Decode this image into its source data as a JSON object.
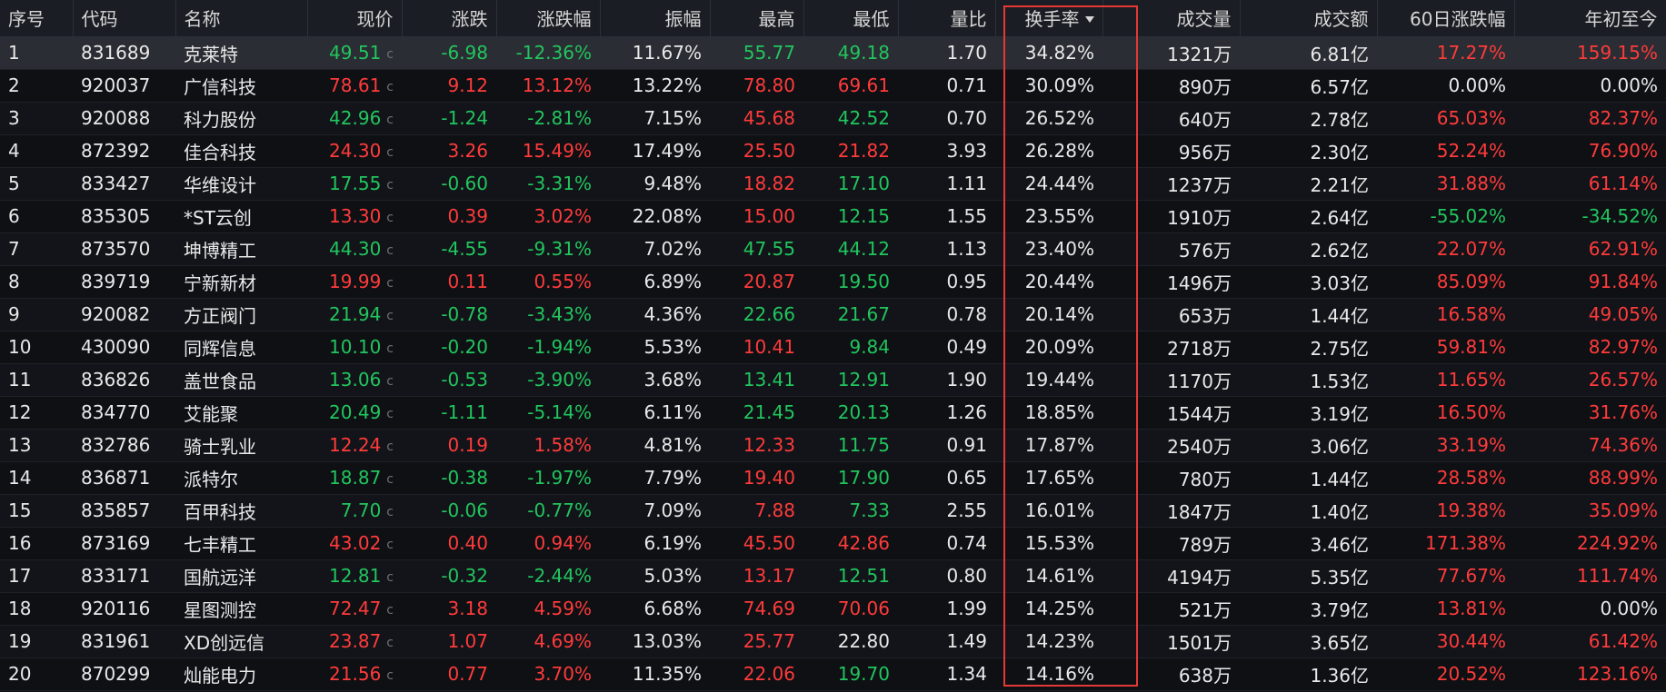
{
  "columns": {
    "seq": "序号",
    "code": "代码",
    "name": "名称",
    "price": "现价",
    "change": "涨跌",
    "change_pct": "涨跌幅",
    "amplitude": "振幅",
    "high": "最高",
    "low": "最低",
    "vol_ratio": "量比",
    "turnover": "换手率",
    "volume": "成交量",
    "amount": "成交额",
    "chg60": "60日涨跌幅",
    "ytd": "年初至今"
  },
  "price_suffix": "c",
  "colors": {
    "up": "#ff3b3b",
    "down": "#22c55e",
    "flat": "#e9e9e9",
    "highlight": "#e53935"
  },
  "rows": [
    {
      "seq": "1",
      "code": "831689",
      "name": "克莱特",
      "price": "49.51",
      "change": "-6.98",
      "change_pct": "-12.36%",
      "amplitude": "11.67%",
      "high": "55.77",
      "low": "49.18",
      "vol_ratio": "1.70",
      "turnover": "34.82%",
      "volume": "1321万",
      "amount": "6.81亿",
      "chg60": "17.27%",
      "ytd": "159.15%",
      "price_color": "green",
      "change_color": "green",
      "high_color": "green",
      "low_color": "green",
      "chg60_color": "red",
      "ytd_color": "red"
    },
    {
      "seq": "2",
      "code": "920037",
      "name": "广信科技",
      "price": "78.61",
      "change": "9.12",
      "change_pct": "13.12%",
      "amplitude": "13.22%",
      "high": "78.80",
      "low": "69.61",
      "vol_ratio": "0.71",
      "turnover": "30.09%",
      "volume": "890万",
      "amount": "6.57亿",
      "chg60": "0.00%",
      "ytd": "0.00%",
      "price_color": "red",
      "change_color": "red",
      "high_color": "red",
      "low_color": "red",
      "chg60_color": "white",
      "ytd_color": "white"
    },
    {
      "seq": "3",
      "code": "920088",
      "name": "科力股份",
      "price": "42.96",
      "change": "-1.24",
      "change_pct": "-2.81%",
      "amplitude": "7.15%",
      "high": "45.68",
      "low": "42.52",
      "vol_ratio": "0.70",
      "turnover": "26.52%",
      "volume": "640万",
      "amount": "2.78亿",
      "chg60": "65.03%",
      "ytd": "82.37%",
      "price_color": "green",
      "change_color": "green",
      "high_color": "red",
      "low_color": "green",
      "chg60_color": "red",
      "ytd_color": "red"
    },
    {
      "seq": "4",
      "code": "872392",
      "name": "佳合科技",
      "price": "24.30",
      "change": "3.26",
      "change_pct": "15.49%",
      "amplitude": "17.49%",
      "high": "25.50",
      "low": "21.82",
      "vol_ratio": "3.93",
      "turnover": "26.28%",
      "volume": "956万",
      "amount": "2.30亿",
      "chg60": "52.24%",
      "ytd": "76.90%",
      "price_color": "red",
      "change_color": "red",
      "high_color": "red",
      "low_color": "red",
      "chg60_color": "red",
      "ytd_color": "red"
    },
    {
      "seq": "5",
      "code": "833427",
      "name": "华维设计",
      "price": "17.55",
      "change": "-0.60",
      "change_pct": "-3.31%",
      "amplitude": "9.48%",
      "high": "18.82",
      "low": "17.10",
      "vol_ratio": "1.11",
      "turnover": "24.44%",
      "volume": "1237万",
      "amount": "2.21亿",
      "chg60": "31.88%",
      "ytd": "61.14%",
      "price_color": "green",
      "change_color": "green",
      "high_color": "red",
      "low_color": "green",
      "chg60_color": "red",
      "ytd_color": "red"
    },
    {
      "seq": "6",
      "code": "835305",
      "name": "*ST云创",
      "price": "13.30",
      "change": "0.39",
      "change_pct": "3.02%",
      "amplitude": "22.08%",
      "high": "15.00",
      "low": "12.15",
      "vol_ratio": "1.55",
      "turnover": "23.55%",
      "volume": "1910万",
      "amount": "2.64亿",
      "chg60": "-55.02%",
      "ytd": "-34.52%",
      "price_color": "red",
      "change_color": "red",
      "high_color": "red",
      "low_color": "green",
      "chg60_color": "green",
      "ytd_color": "green"
    },
    {
      "seq": "7",
      "code": "873570",
      "name": "坤博精工",
      "price": "44.30",
      "change": "-4.55",
      "change_pct": "-9.31%",
      "amplitude": "7.02%",
      "high": "47.55",
      "low": "44.12",
      "vol_ratio": "1.13",
      "turnover": "23.40%",
      "volume": "576万",
      "amount": "2.62亿",
      "chg60": "22.07%",
      "ytd": "62.91%",
      "price_color": "green",
      "change_color": "green",
      "high_color": "green",
      "low_color": "green",
      "chg60_color": "red",
      "ytd_color": "red"
    },
    {
      "seq": "8",
      "code": "839719",
      "name": "宁新新材",
      "price": "19.99",
      "change": "0.11",
      "change_pct": "0.55%",
      "amplitude": "6.89%",
      "high": "20.87",
      "low": "19.50",
      "vol_ratio": "0.95",
      "turnover": "20.44%",
      "volume": "1496万",
      "amount": "3.03亿",
      "chg60": "85.09%",
      "ytd": "91.84%",
      "price_color": "red",
      "change_color": "red",
      "high_color": "red",
      "low_color": "green",
      "chg60_color": "red",
      "ytd_color": "red"
    },
    {
      "seq": "9",
      "code": "920082",
      "name": "方正阀门",
      "price": "21.94",
      "change": "-0.78",
      "change_pct": "-3.43%",
      "amplitude": "4.36%",
      "high": "22.66",
      "low": "21.67",
      "vol_ratio": "0.78",
      "turnover": "20.14%",
      "volume": "653万",
      "amount": "1.44亿",
      "chg60": "16.58%",
      "ytd": "49.05%",
      "price_color": "green",
      "change_color": "green",
      "high_color": "green",
      "low_color": "green",
      "chg60_color": "red",
      "ytd_color": "red"
    },
    {
      "seq": "10",
      "code": "430090",
      "name": "同辉信息",
      "price": "10.10",
      "change": "-0.20",
      "change_pct": "-1.94%",
      "amplitude": "5.53%",
      "high": "10.41",
      "low": "9.84",
      "vol_ratio": "0.49",
      "turnover": "20.09%",
      "volume": "2718万",
      "amount": "2.75亿",
      "chg60": "59.81%",
      "ytd": "82.97%",
      "price_color": "green",
      "change_color": "green",
      "high_color": "red",
      "low_color": "green",
      "chg60_color": "red",
      "ytd_color": "red"
    },
    {
      "seq": "11",
      "code": "836826",
      "name": "盖世食品",
      "price": "13.06",
      "change": "-0.53",
      "change_pct": "-3.90%",
      "amplitude": "3.68%",
      "high": "13.41",
      "low": "12.91",
      "vol_ratio": "1.90",
      "turnover": "19.44%",
      "volume": "1170万",
      "amount": "1.53亿",
      "chg60": "11.65%",
      "ytd": "26.57%",
      "price_color": "green",
      "change_color": "green",
      "high_color": "green",
      "low_color": "green",
      "chg60_color": "red",
      "ytd_color": "red"
    },
    {
      "seq": "12",
      "code": "834770",
      "name": "艾能聚",
      "price": "20.49",
      "change": "-1.11",
      "change_pct": "-5.14%",
      "amplitude": "6.11%",
      "high": "21.45",
      "low": "20.13",
      "vol_ratio": "1.26",
      "turnover": "18.85%",
      "volume": "1544万",
      "amount": "3.19亿",
      "chg60": "16.50%",
      "ytd": "31.76%",
      "price_color": "green",
      "change_color": "green",
      "high_color": "green",
      "low_color": "green",
      "chg60_color": "red",
      "ytd_color": "red"
    },
    {
      "seq": "13",
      "code": "832786",
      "name": "骑士乳业",
      "price": "12.24",
      "change": "0.19",
      "change_pct": "1.58%",
      "amplitude": "4.81%",
      "high": "12.33",
      "low": "11.75",
      "vol_ratio": "0.91",
      "turnover": "17.87%",
      "volume": "2540万",
      "amount": "3.06亿",
      "chg60": "33.19%",
      "ytd": "74.36%",
      "price_color": "red",
      "change_color": "red",
      "high_color": "red",
      "low_color": "green",
      "chg60_color": "red",
      "ytd_color": "red"
    },
    {
      "seq": "14",
      "code": "836871",
      "name": "派特尔",
      "price": "18.87",
      "change": "-0.38",
      "change_pct": "-1.97%",
      "amplitude": "7.79%",
      "high": "19.40",
      "low": "17.90",
      "vol_ratio": "0.65",
      "turnover": "17.65%",
      "volume": "780万",
      "amount": "1.44亿",
      "chg60": "28.58%",
      "ytd": "88.99%",
      "price_color": "green",
      "change_color": "green",
      "high_color": "red",
      "low_color": "green",
      "chg60_color": "red",
      "ytd_color": "red"
    },
    {
      "seq": "15",
      "code": "835857",
      "name": "百甲科技",
      "price": "7.70",
      "change": "-0.06",
      "change_pct": "-0.77%",
      "amplitude": "7.09%",
      "high": "7.88",
      "low": "7.33",
      "vol_ratio": "2.55",
      "turnover": "16.01%",
      "volume": "1847万",
      "amount": "1.40亿",
      "chg60": "19.38%",
      "ytd": "35.09%",
      "price_color": "green",
      "change_color": "green",
      "high_color": "red",
      "low_color": "green",
      "chg60_color": "red",
      "ytd_color": "red"
    },
    {
      "seq": "16",
      "code": "873169",
      "name": "七丰精工",
      "price": "43.02",
      "change": "0.40",
      "change_pct": "0.94%",
      "amplitude": "6.19%",
      "high": "45.50",
      "low": "42.86",
      "vol_ratio": "0.74",
      "turnover": "15.53%",
      "volume": "789万",
      "amount": "3.46亿",
      "chg60": "171.38%",
      "ytd": "224.92%",
      "price_color": "red",
      "change_color": "red",
      "high_color": "red",
      "low_color": "red",
      "chg60_color": "red",
      "ytd_color": "red"
    },
    {
      "seq": "17",
      "code": "833171",
      "name": "国航远洋",
      "price": "12.81",
      "change": "-0.32",
      "change_pct": "-2.44%",
      "amplitude": "5.03%",
      "high": "13.17",
      "low": "12.51",
      "vol_ratio": "0.80",
      "turnover": "14.61%",
      "volume": "4194万",
      "amount": "5.35亿",
      "chg60": "77.67%",
      "ytd": "111.74%",
      "price_color": "green",
      "change_color": "green",
      "high_color": "red",
      "low_color": "green",
      "chg60_color": "red",
      "ytd_color": "red"
    },
    {
      "seq": "18",
      "code": "920116",
      "name": "星图测控",
      "price": "72.47",
      "change": "3.18",
      "change_pct": "4.59%",
      "amplitude": "6.68%",
      "high": "74.69",
      "low": "70.06",
      "vol_ratio": "1.99",
      "turnover": "14.25%",
      "volume": "521万",
      "amount": "3.79亿",
      "chg60": "13.81%",
      "ytd": "0.00%",
      "price_color": "red",
      "change_color": "red",
      "high_color": "red",
      "low_color": "red",
      "chg60_color": "red",
      "ytd_color": "white"
    },
    {
      "seq": "19",
      "code": "831961",
      "name": "XD创远信",
      "price": "23.87",
      "change": "1.07",
      "change_pct": "4.69%",
      "amplitude": "13.03%",
      "high": "25.77",
      "low": "22.80",
      "vol_ratio": "1.49",
      "turnover": "14.23%",
      "volume": "1501万",
      "amount": "3.65亿",
      "chg60": "30.44%",
      "ytd": "61.42%",
      "price_color": "red",
      "change_color": "red",
      "high_color": "red",
      "low_color": "white",
      "chg60_color": "red",
      "ytd_color": "red"
    },
    {
      "seq": "20",
      "code": "870299",
      "name": "灿能电力",
      "price": "21.56",
      "change": "0.77",
      "change_pct": "3.70%",
      "amplitude": "11.35%",
      "high": "22.06",
      "low": "19.70",
      "vol_ratio": "1.34",
      "turnover": "14.16%",
      "volume": "638万",
      "amount": "1.36亿",
      "chg60": "20.52%",
      "ytd": "123.16%",
      "price_color": "red",
      "change_color": "red",
      "high_color": "red",
      "low_color": "green",
      "chg60_color": "red",
      "ytd_color": "red"
    }
  ]
}
